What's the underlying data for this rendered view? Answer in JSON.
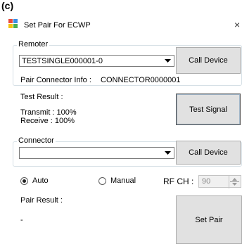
{
  "figure_label": "(c)",
  "window": {
    "title": "Set Pair For ECWP",
    "close_glyph": "×"
  },
  "remoter": {
    "legend": "Remoter",
    "selected": "TESTSINGLE000001-0",
    "call_button": "Call Device",
    "pair_info_label": "Pair Connector Info :",
    "pair_info_value": "CONNECTOR0000001",
    "test_result_label": "Test Result :",
    "transmit": "Transmit : 100%",
    "receive": "Receive : 100%",
    "test_button": "Test Signal"
  },
  "connector": {
    "legend": "Connector",
    "selected": "",
    "call_button": "Call Device"
  },
  "mode": {
    "auto_label": "Auto",
    "manual_label": "Manual",
    "selected": "auto",
    "rf_label": "RF CH :",
    "rf_value": "90"
  },
  "pair": {
    "result_label": "Pair Result :",
    "result_value": "-",
    "button": "Set Pair"
  },
  "icons": [
    "app-icon",
    "close-icon",
    "chevron-down-icon",
    "spin-up-icon",
    "spin-down-icon"
  ]
}
